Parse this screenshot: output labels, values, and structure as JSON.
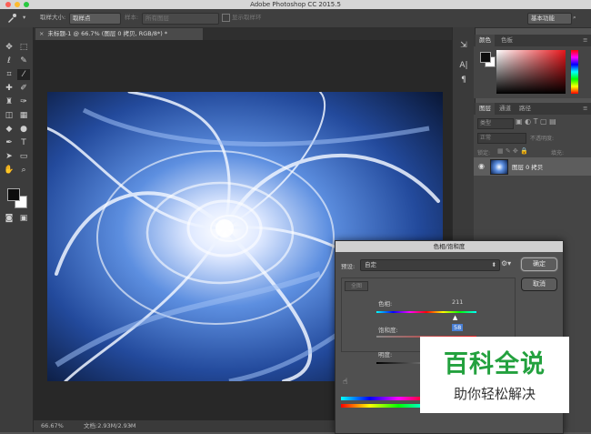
{
  "window": {
    "title": "Adobe Photoshop CC 2015.5"
  },
  "options_bar": {
    "sample_size_label": "取样大小:",
    "sample_size_value": "取样点",
    "sample_label": "样本:",
    "sample_value": "所有图层",
    "show_ring_label": "显示取样环",
    "workspace": "基本功能"
  },
  "document": {
    "tab_label": "未标题-1 @ 66.7% (图层 0 拷贝, RGB/8*) *",
    "zoom": "66.67%",
    "doc_info": "文档:2.93M/2.93M"
  },
  "color_panel": {
    "tabs": [
      "颜色",
      "色板"
    ],
    "fg_color": "#0d0d0d",
    "bg_color": "#ffffff"
  },
  "layers_panel": {
    "tabs": [
      "图层",
      "通道",
      "路径"
    ],
    "kind_label": "类型",
    "blend_mode": "正常",
    "opacity_label": "不透明度:",
    "lock_label": "锁定:",
    "fill_label": "填充:",
    "layer_name": "图层 0 拷贝"
  },
  "dialog": {
    "title": "色相/饱和度",
    "preset_label": "预设:",
    "preset_value": "自定",
    "channel_value": "全图",
    "ok": "确定",
    "cancel": "取消",
    "hue_label": "色相:",
    "hue_value": "211",
    "saturation_label": "饱和度:",
    "saturation_value": "58",
    "lightness_label": "明度:",
    "hue_fraction": 0.79,
    "saturation_fraction": 0.79
  },
  "watermark": {
    "title": "百科全说",
    "subtitle": "助你轻松解决"
  },
  "colors": {
    "accent": "#4a90d9",
    "watermark_green": "#23a13e"
  }
}
